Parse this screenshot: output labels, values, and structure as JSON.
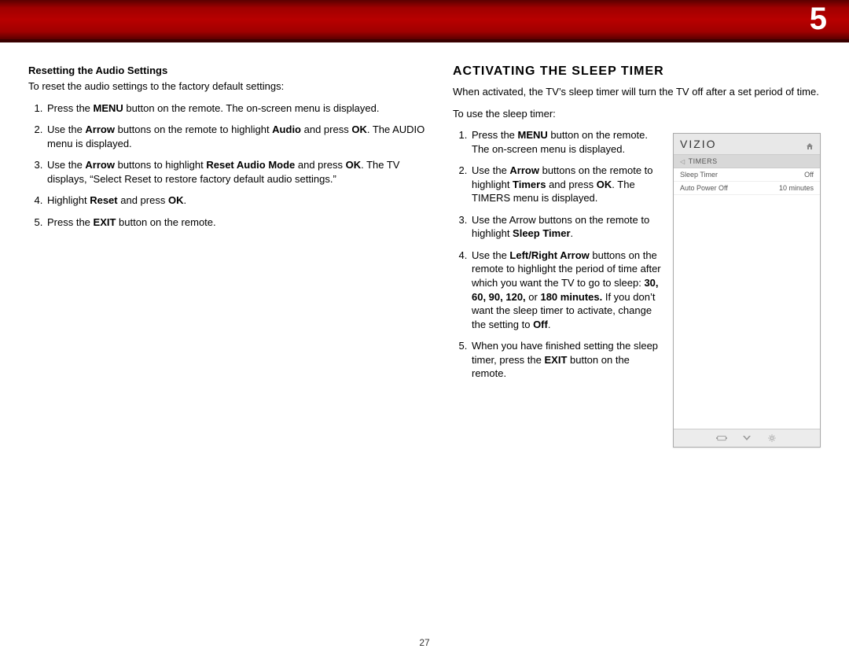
{
  "chapter_number": "5",
  "page_number": "27",
  "left": {
    "heading": "Resetting the Audio Settings",
    "intro": "To reset the audio settings to the factory default settings:",
    "steps": {
      "s1a": "Press the ",
      "s1b": "MENU",
      "s1c": " button on the remote. The on-screen menu is displayed.",
      "s2a": "Use the ",
      "s2b": "Arrow",
      "s2c": " buttons on the remote to highlight ",
      "s2d": "Audio",
      "s2e": " and press ",
      "s2f": "OK",
      "s2g": ". The AUDIO menu is displayed.",
      "s3a": "Use the ",
      "s3b": "Arrow",
      "s3c": " buttons to highlight ",
      "s3d": "Reset Audio Mode",
      "s3e": " and press ",
      "s3f": "OK",
      "s3g": ". The TV displays, “Select Reset to restore factory default audio settings.”",
      "s4a": "Highlight ",
      "s4b": "Reset",
      "s4c": " and press ",
      "s4d": "OK",
      "s4e": ".",
      "s5a": "Press the ",
      "s5b": "EXIT",
      "s5c": " button on the remote."
    }
  },
  "right": {
    "heading": "ACTIVATING THE SLEEP TIMER",
    "intro1": "When activated, the TV’s sleep timer will turn the TV off after a set period of time.",
    "intro2": "To use the sleep timer:",
    "steps": {
      "s1a": "Press the ",
      "s1b": "MENU",
      "s1c": " button on the remote. The on-screen menu is displayed.",
      "s2a": "Use the ",
      "s2b": "Arrow",
      "s2c": " buttons on the remote to highlight ",
      "s2d": "Timers",
      "s2e": " and press ",
      "s2f": "OK",
      "s2g": ". The TIMERS menu is displayed.",
      "s3a": "Use the Arrow buttons on the remote to highlight ",
      "s3b": "Sleep Timer",
      "s3c": ".",
      "s4a": "Use the ",
      "s4b": "Left/Right Arrow",
      "s4c": " buttons on the remote to highlight the period of time after which you want the TV to go to sleep: ",
      "s4d": "30, 60, 90, 120,",
      "s4e": " or ",
      "s4f": "180 minutes.",
      "s4g": " If you don’t want the sleep timer to activate, change the setting to ",
      "s4h": "Off",
      "s4i": ".",
      "s5a": "When you have finished setting the sleep timer, press the ",
      "s5b": "EXIT",
      "s5c": " button on the remote."
    }
  },
  "menu": {
    "brand": "VIZIO",
    "section": "TIMERS",
    "rows": [
      {
        "label": "Sleep Timer",
        "value": "Off"
      },
      {
        "label": "Auto Power Off",
        "value": "10 minutes"
      }
    ]
  }
}
